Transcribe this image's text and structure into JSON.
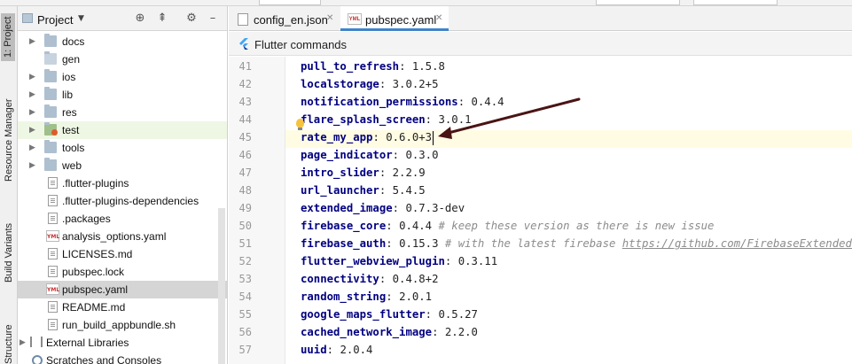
{
  "toolwindow_strip": {
    "project": "1: Project",
    "resource_manager": "Resource Manager",
    "build_variants": "Build Variants",
    "structure": "Structure"
  },
  "project_panel": {
    "title": "Project",
    "dropdown_icon": "chevron-down-icon",
    "header_icons": [
      "target-icon",
      "collapse-icon",
      "gear-icon",
      "minimize-icon"
    ],
    "tree": [
      {
        "label": "docs",
        "type": "folder",
        "expandable": true
      },
      {
        "label": "gen",
        "type": "folder-generated",
        "expandable": false
      },
      {
        "label": "ios",
        "type": "folder",
        "expandable": true
      },
      {
        "label": "lib",
        "type": "folder",
        "expandable": true
      },
      {
        "label": "res",
        "type": "folder",
        "expandable": true
      },
      {
        "label": "test",
        "type": "folder-test",
        "expandable": true
      },
      {
        "label": "tools",
        "type": "folder",
        "expandable": true
      },
      {
        "label": "web",
        "type": "folder",
        "expandable": true
      },
      {
        "label": ".flutter-plugins",
        "type": "file"
      },
      {
        "label": ".flutter-plugins-dependencies",
        "type": "file"
      },
      {
        "label": ".packages",
        "type": "file"
      },
      {
        "label": "analysis_options.yaml",
        "type": "yaml"
      },
      {
        "label": "LICENSES.md",
        "type": "file"
      },
      {
        "label": "pubspec.lock",
        "type": "file"
      },
      {
        "label": "pubspec.yaml",
        "type": "yaml"
      },
      {
        "label": "README.md",
        "type": "file"
      },
      {
        "label": "run_build_appbundle.sh",
        "type": "file"
      },
      {
        "label": "External Libraries",
        "type": "library",
        "expandable": true
      },
      {
        "label": "Scratches and Consoles",
        "type": "scratches",
        "expandable": false
      }
    ]
  },
  "editor": {
    "tabs": [
      {
        "label": "config_en.json",
        "active": false,
        "icon": "json-file-icon"
      },
      {
        "label": "pubspec.yaml",
        "active": true,
        "icon": "yaml-file-icon"
      }
    ],
    "command_bar": {
      "label": "Flutter commands",
      "icon": "flutter-icon"
    },
    "lines": [
      {
        "num": "41",
        "key": "pull_to_refresh",
        "value": "1.5.8"
      },
      {
        "num": "42",
        "key": "localstorage",
        "value": "3.0.2+5"
      },
      {
        "num": "43",
        "key": "notification_permissions",
        "value": "0.4.4"
      },
      {
        "num": "44",
        "key": "flare_splash_screen",
        "value": "3.0.1"
      },
      {
        "num": "45",
        "key": "rate_my_app",
        "value": "0.6.0+3"
      },
      {
        "num": "46",
        "key": "page_indicator",
        "value": "0.3.0"
      },
      {
        "num": "47",
        "key": "intro_slider",
        "value": "2.2.9"
      },
      {
        "num": "48",
        "key": "url_launcher",
        "value": "5.4.5"
      },
      {
        "num": "49",
        "key": "extended_image",
        "value": "0.7.3-dev"
      },
      {
        "num": "50",
        "key": "firebase_core",
        "value": "0.4.4",
        "comment": "# keep these version as there is new issue"
      },
      {
        "num": "51",
        "key": "firebase_auth",
        "value": "0.15.3",
        "comment": "# with the latest firebase ",
        "url": "https://github.com/FirebaseExtended/flut"
      },
      {
        "num": "52",
        "key": "flutter_webview_plugin",
        "value": "0.3.11"
      },
      {
        "num": "53",
        "key": "connectivity",
        "value": "0.4.8+2"
      },
      {
        "num": "54",
        "key": "random_string",
        "value": "2.0.1"
      },
      {
        "num": "55",
        "key": "google_maps_flutter",
        "value": "0.5.27"
      },
      {
        "num": "56",
        "key": "cached_network_image",
        "value": "2.2.0"
      },
      {
        "num": "57",
        "key": "uuid",
        "value": "2.0.4"
      }
    ],
    "current_line": "45",
    "intention_bulb_line": "44"
  },
  "annotation": {
    "type": "arrow",
    "color": "#4a1414",
    "points_to_line": "45"
  }
}
